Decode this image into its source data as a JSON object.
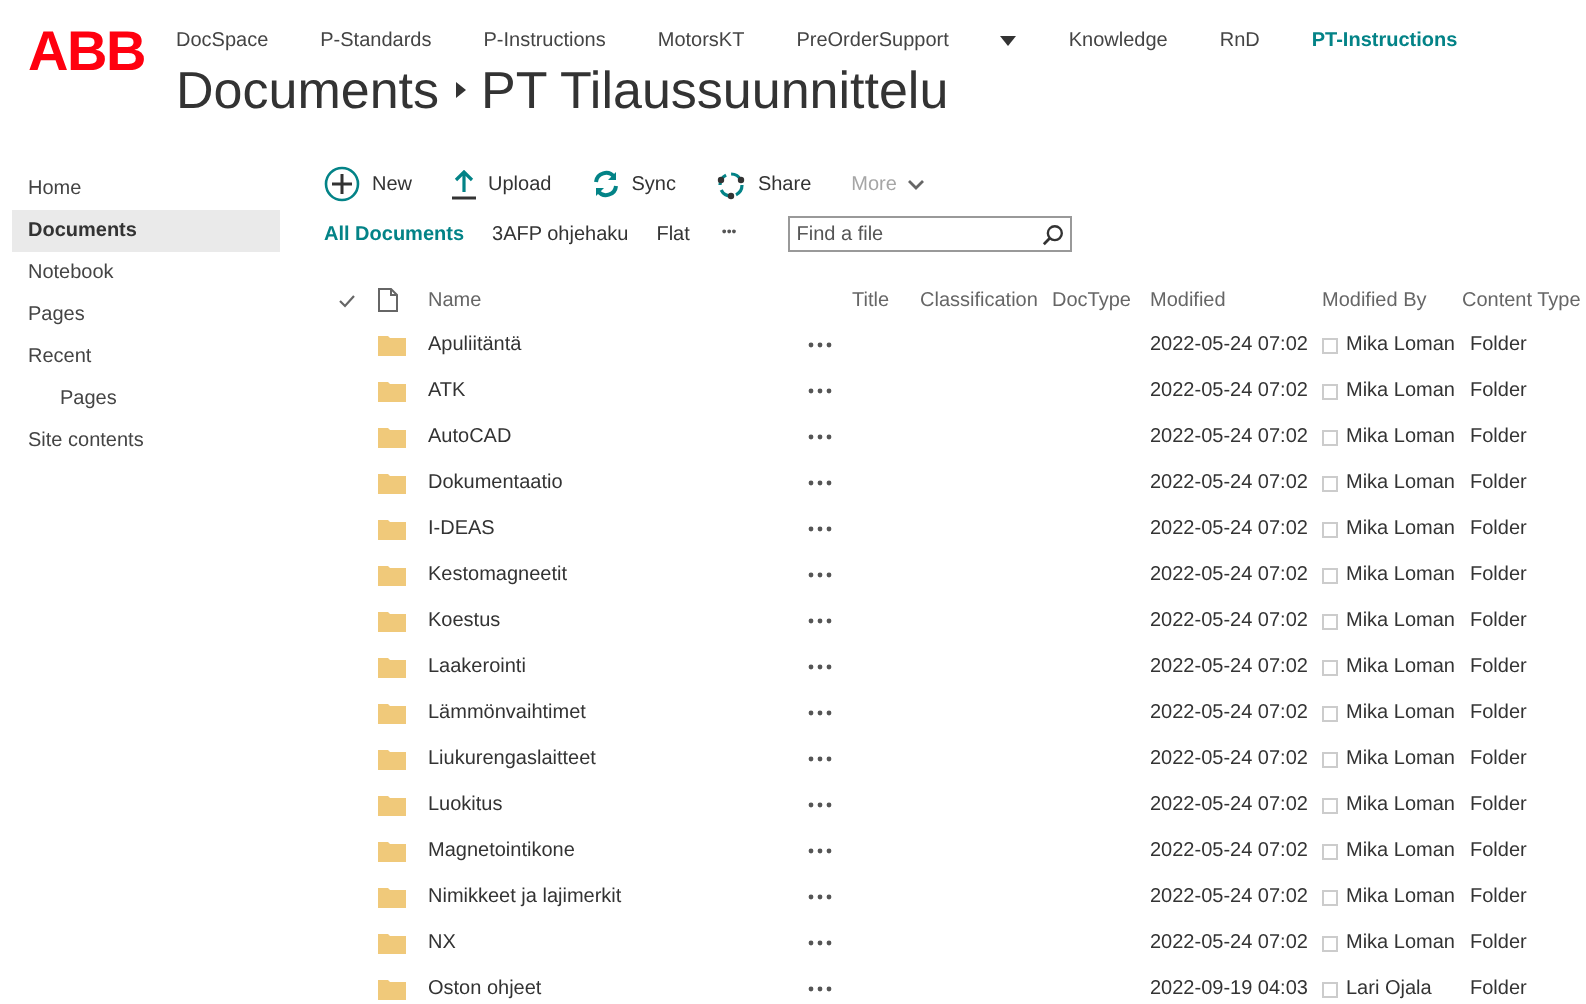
{
  "logo": "ABB",
  "top_nav": [
    {
      "label": "DocSpace",
      "selected": false
    },
    {
      "label": "P-Standards",
      "selected": false
    },
    {
      "label": "P-Instructions",
      "selected": false
    },
    {
      "label": "MotorsKT",
      "selected": false
    },
    {
      "label": "PreOrderSupport",
      "selected": false,
      "dropdown": true
    },
    {
      "label": "Knowledge",
      "selected": false
    },
    {
      "label": "RnD",
      "selected": false
    },
    {
      "label": "PT-Instructions",
      "selected": true
    }
  ],
  "breadcrumb": [
    "Documents",
    "PT Tilaussuunnittelu"
  ],
  "sidebar": {
    "items": [
      {
        "label": "Home",
        "selected": false
      },
      {
        "label": "Documents",
        "selected": true
      },
      {
        "label": "Notebook",
        "selected": false
      },
      {
        "label": "Pages",
        "selected": false
      },
      {
        "label": "Recent",
        "selected": false,
        "children": [
          {
            "label": "Pages",
            "selected": false
          }
        ]
      },
      {
        "label": "Site contents",
        "selected": false
      }
    ]
  },
  "toolbar": [
    {
      "kind": "new",
      "label": "New"
    },
    {
      "kind": "upload",
      "label": "Upload"
    },
    {
      "kind": "sync",
      "label": "Sync"
    },
    {
      "kind": "share",
      "label": "Share"
    },
    {
      "kind": "more",
      "label": "More",
      "disabled": true
    }
  ],
  "views": [
    {
      "label": "All Documents",
      "selected": true
    },
    {
      "label": "3AFP ohjehaku",
      "selected": false
    },
    {
      "label": "Flat",
      "selected": false
    }
  ],
  "views_more": "•••",
  "search": {
    "placeholder": "Find a file"
  },
  "table": {
    "columns": [
      "Name",
      "Title",
      "Classification",
      "DocType",
      "Modified",
      "Modified By",
      "Content Type"
    ],
    "rows": [
      {
        "name": "Apuliitäntä",
        "modified": "2022-05-24 07:02",
        "modified_by": "Mika Loman",
        "content_type": "Folder"
      },
      {
        "name": "ATK",
        "modified": "2022-05-24 07:02",
        "modified_by": "Mika Loman",
        "content_type": "Folder"
      },
      {
        "name": "AutoCAD",
        "modified": "2022-05-24 07:02",
        "modified_by": "Mika Loman",
        "content_type": "Folder"
      },
      {
        "name": "Dokumentaatio",
        "modified": "2022-05-24 07:02",
        "modified_by": "Mika Loman",
        "content_type": "Folder"
      },
      {
        "name": "I-DEAS",
        "modified": "2022-05-24 07:02",
        "modified_by": "Mika Loman",
        "content_type": "Folder"
      },
      {
        "name": "Kestomagneetit",
        "modified": "2022-05-24 07:02",
        "modified_by": "Mika Loman",
        "content_type": "Folder"
      },
      {
        "name": "Koestus",
        "modified": "2022-05-24 07:02",
        "modified_by": "Mika Loman",
        "content_type": "Folder"
      },
      {
        "name": "Laakerointi",
        "modified": "2022-05-24 07:02",
        "modified_by": "Mika Loman",
        "content_type": "Folder"
      },
      {
        "name": "Lämmönvaihtimet",
        "modified": "2022-05-24 07:02",
        "modified_by": "Mika Loman",
        "content_type": "Folder"
      },
      {
        "name": "Liukurengaslaitteet",
        "modified": "2022-05-24 07:02",
        "modified_by": "Mika Loman",
        "content_type": "Folder"
      },
      {
        "name": "Luokitus",
        "modified": "2022-05-24 07:02",
        "modified_by": "Mika Loman",
        "content_type": "Folder"
      },
      {
        "name": "Magnetointikone",
        "modified": "2022-05-24 07:02",
        "modified_by": "Mika Loman",
        "content_type": "Folder"
      },
      {
        "name": "Nimikkeet ja lajimerkit",
        "modified": "2022-05-24 07:02",
        "modified_by": "Mika Loman",
        "content_type": "Folder"
      },
      {
        "name": "NX",
        "modified": "2022-05-24 07:02",
        "modified_by": "Mika Loman",
        "content_type": "Folder"
      },
      {
        "name": "Oston ohjeet",
        "modified": "2022-09-19 04:03",
        "modified_by": "Lari Ojala",
        "content_type": "Folder"
      }
    ]
  }
}
